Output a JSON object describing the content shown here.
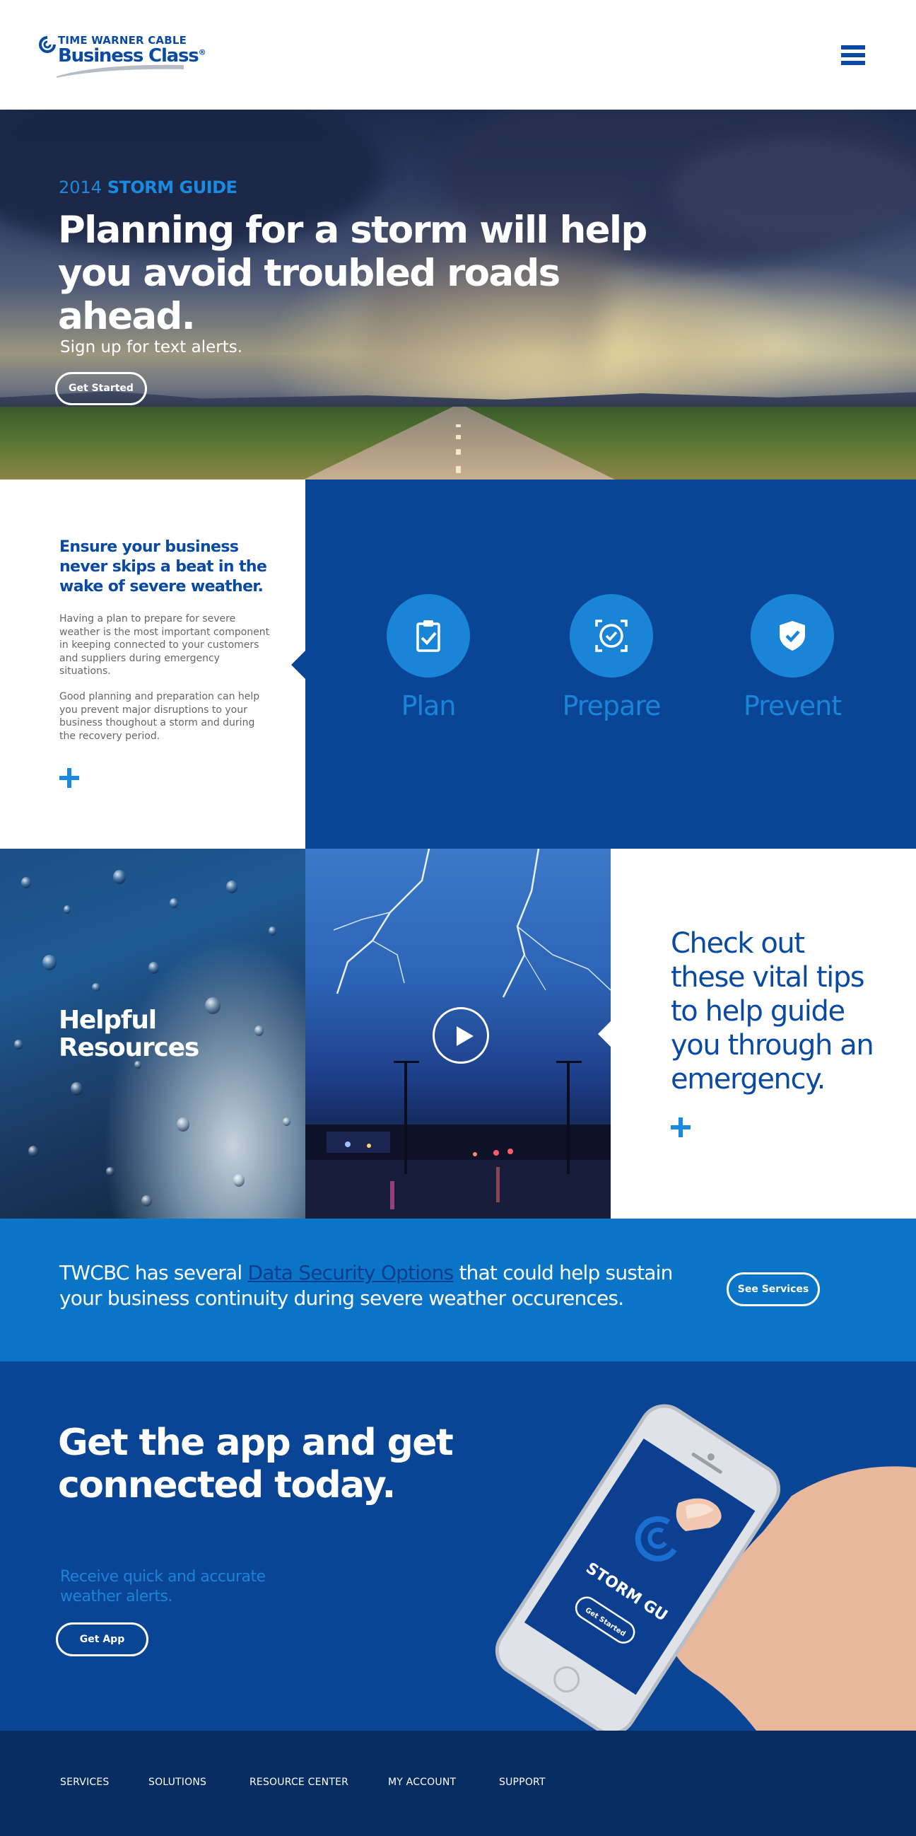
{
  "brand": {
    "line1": "TIME WARNER CABLE",
    "line2": "Business Class",
    "mark": "®"
  },
  "header": {
    "menu_icon": "hamburger-menu-icon"
  },
  "hero": {
    "year": "2014",
    "guide": "STORM GUIDE",
    "title": "Planning for a storm will help you avoid troubled roads ahead.",
    "subtitle": "Sign up for text alerts.",
    "button": "Get Started"
  },
  "ensure": {
    "title": "Ensure your business never skips a beat in the wake of severe weather.",
    "p1": "Having a plan to prepare for severe weather is the most important component in keeping connected to your customers and suppliers during emergency situations.",
    "p2": "Good planning and preparation can help you prevent major disruptions to your business thoughout a storm and during the recovery period."
  },
  "steps": [
    {
      "label": "Plan",
      "icon": "clipboard-check-icon"
    },
    {
      "label": "Prepare",
      "icon": "target-check-icon"
    },
    {
      "label": "Prevent",
      "icon": "shield-check-icon"
    }
  ],
  "resources": {
    "title": "Helpful Resources",
    "tips": "Check out these vital tips to help guide you through an emergency."
  },
  "banner": {
    "pre": "TWCBC has several ",
    "link": "Data Security Options",
    "post": " that could help sustain your business continuity during severe weather occurences.",
    "button": "See Services"
  },
  "app": {
    "title": "Get the app and get connected today.",
    "subtitle": "Receive quick and accurate weather alerts.",
    "button": "Get App",
    "phone_screen_text": "STORM GU",
    "phone_button": "Get Started"
  },
  "footer": [
    "SERVICES",
    "SOLUTIONS",
    "RESOURCE CENTER",
    "MY ACCOUNT",
    "SUPPORT"
  ],
  "colors": {
    "brand_blue": "#0b4aa2",
    "accent_blue": "#1a84d6",
    "banner_blue": "#0a74c6",
    "footer_navy": "#062c62"
  }
}
